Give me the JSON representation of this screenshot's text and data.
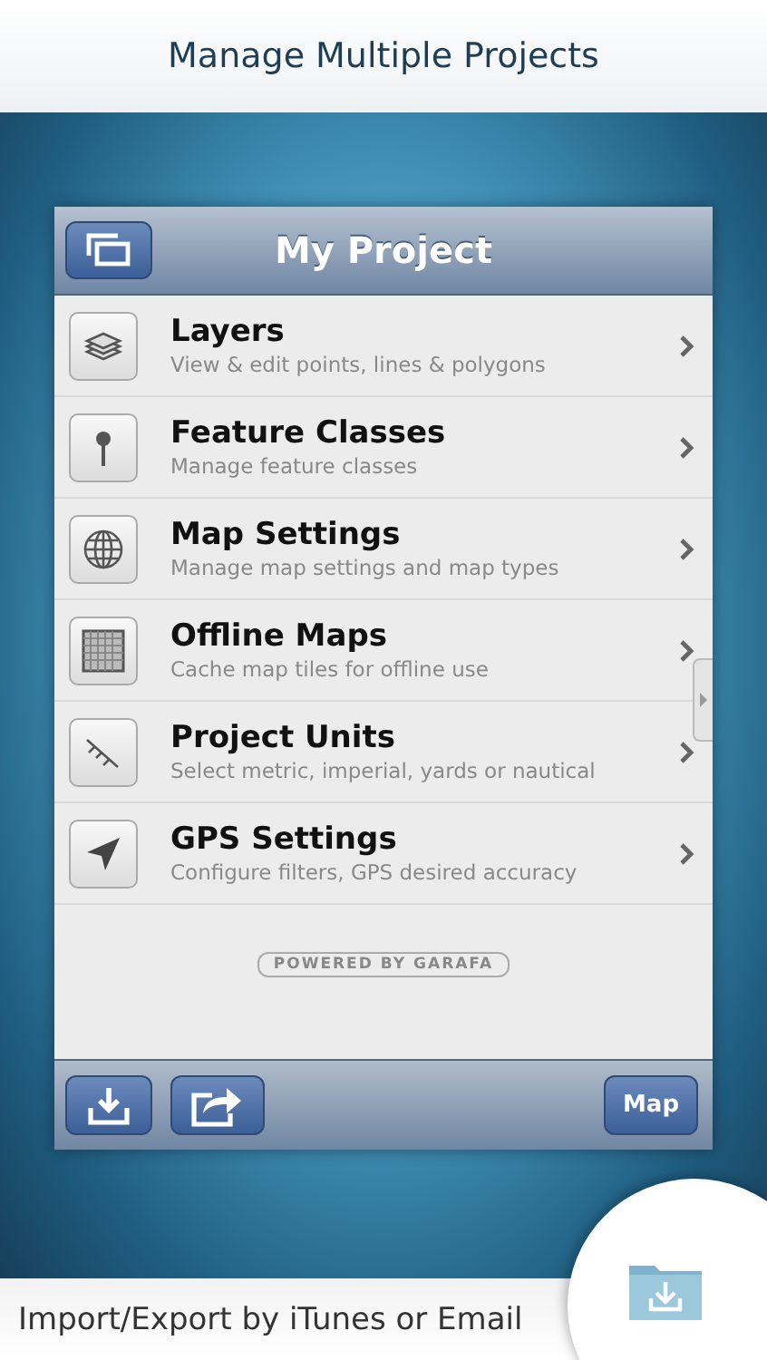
{
  "headline": "Manage Multiple Projects",
  "navbar": {
    "title": "My Project"
  },
  "menu": [
    {
      "title": "Layers",
      "subtitle": "View & edit points, lines & polygons"
    },
    {
      "title": "Feature Classes",
      "subtitle": "Manage feature classes"
    },
    {
      "title": "Map Settings",
      "subtitle": "Manage map settings and map types"
    },
    {
      "title": "Offline Maps",
      "subtitle": "Cache map tiles for offline use"
    },
    {
      "title": "Project Units",
      "subtitle": "Select metric, imperial, yards or nautical"
    },
    {
      "title": "GPS Settings",
      "subtitle": "Configure filters, GPS desired accuracy"
    }
  ],
  "badge": "POWERED BY GARAFA",
  "toolbar": {
    "map_button": "Map"
  },
  "caption": "Import/Export by iTunes or Email"
}
